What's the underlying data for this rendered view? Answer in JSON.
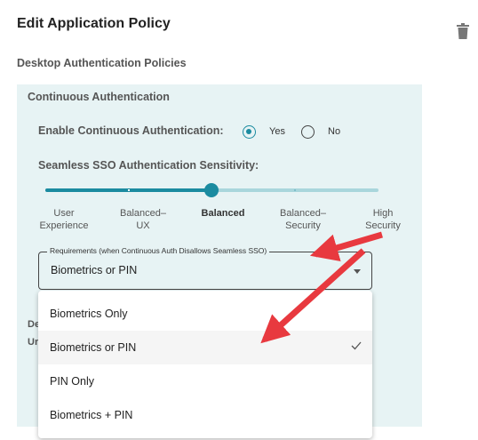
{
  "page": {
    "title": "Edit Application Policy"
  },
  "section": {
    "title": "Desktop Authentication Policies"
  },
  "continuous_auth": {
    "title": "Continuous Authentication",
    "enable_label": "Enable Continuous Authentication:",
    "yes_label": "Yes",
    "no_label": "No",
    "selected": "Yes"
  },
  "sensitivity": {
    "label": "Seamless SSO Authentication Sensitivity:",
    "options": [
      "User\nExperience",
      "Balanced–\nUX",
      "Balanced",
      "Balanced–\nSecurity",
      "High\nSecurity"
    ],
    "selected_index": 2,
    "level_fraction": 0.5
  },
  "requirements": {
    "legend": "Requirements (when Continuous Auth Disallows Seamless SSO)",
    "value": "Biometrics or PIN",
    "options": [
      "Biometrics Only",
      "Biometrics or PIN",
      "PIN Only",
      "Biometrics + PIN"
    ],
    "selected_index": 1
  },
  "obscured": {
    "line1": "De",
    "line2": "Ur"
  },
  "colors": {
    "accent": "#1b8ba0",
    "panel_bg": "#e7f3f4",
    "annotation_arrow": "#e8393f"
  },
  "icons": {
    "delete": "trash-icon",
    "check": "check-icon",
    "dropdown": "caret-down-icon"
  }
}
